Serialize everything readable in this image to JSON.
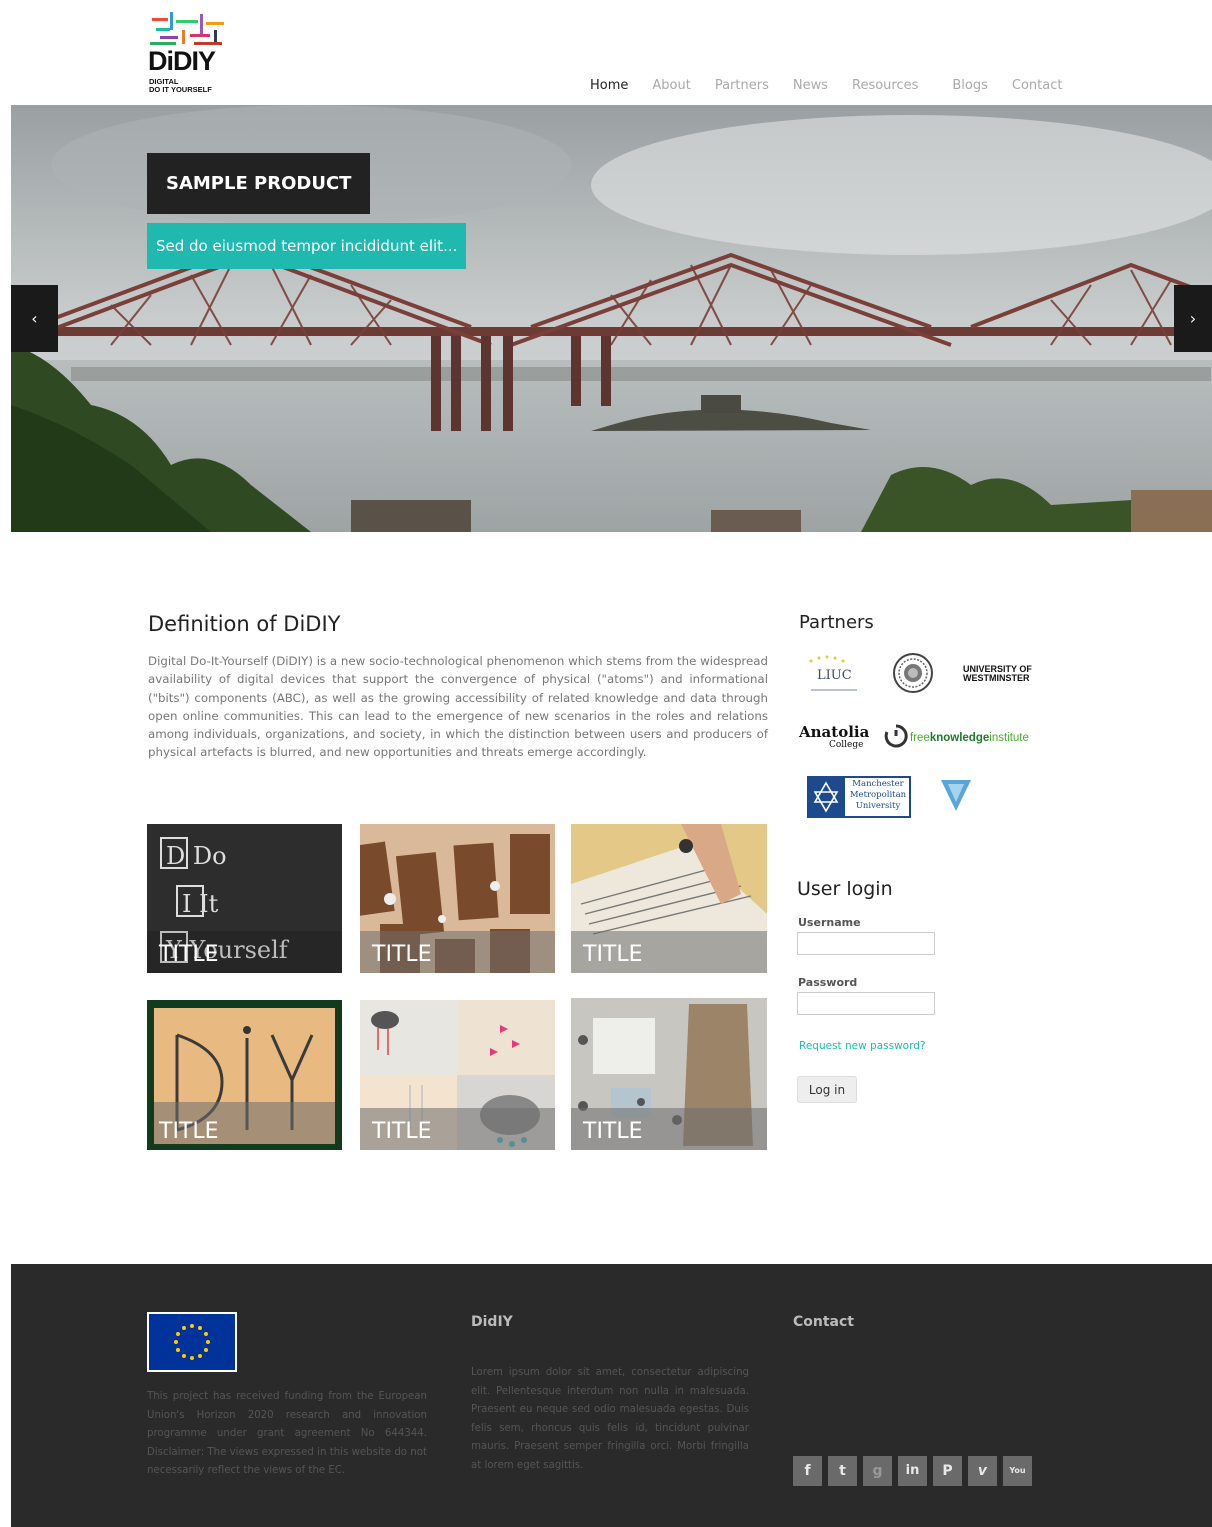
{
  "brand": {
    "name": "DiDIY",
    "tagline_line1": "DIGITAL",
    "tagline_line2": "DO IT YOURSELF"
  },
  "nav": {
    "items": [
      {
        "label": "Home",
        "active": true
      },
      {
        "label": "About"
      },
      {
        "label": "Partners"
      },
      {
        "label": "News"
      },
      {
        "label": "Resources"
      },
      {
        "label": "Blogs"
      },
      {
        "label": "Contact"
      }
    ]
  },
  "slider": {
    "title": "SAMPLE PRODUCT",
    "caption": "Sed do eiusmod tempor incididunt elit...",
    "prev_icon": "chevron-left-icon",
    "next_icon": "chevron-right-icon",
    "prev_glyph": "‹",
    "next_glyph": "›"
  },
  "definition": {
    "title": "Definition of DiDIY",
    "text": "Digital Do-It-Yourself (DiDIY) is a new socio-technological phenomenon which stems from the widespread availability of digital devices that support the convergence of physical (\"atoms\") and informational (\"bits\") components (ABC), as well as the growing accessibility of related knowledge and data through open online communities. This can lead to the emergence of new scenarios in the roles and relations among individuals, organizations, and society, in which the distinction between users and producers of physical artefacts is blurred, and new opportunities and threats emerge accordingly."
  },
  "tiles": [
    {
      "label": "TITLE",
      "art_text": [
        "D Do",
        "I It",
        "Y Yourself"
      ]
    },
    {
      "label": "TITLE"
    },
    {
      "label": "TITLE"
    },
    {
      "label": "TITLE",
      "art_text": [
        "DIY"
      ]
    },
    {
      "label": "TITLE"
    },
    {
      "label": "TITLE"
    }
  ],
  "partners": {
    "title": "Partners",
    "logos": [
      {
        "name": "LIUC",
        "text": "LIUC"
      },
      {
        "name": "university-seal"
      },
      {
        "name": "University of Westminster",
        "line1": "UNIVERSITY OF",
        "line2": "WESTMINSTER"
      },
      {
        "name": "Anatolia College",
        "line1": "Anatolia",
        "line2": "College"
      },
      {
        "name": "freeknowledgeinstitute",
        "part1": "free",
        "part2": "knowledge",
        "part3": "institute"
      },
      {
        "name": "Manchester Metropolitan University",
        "line1": "Manchester",
        "line2": "Metropolitan",
        "line3": "University"
      },
      {
        "name": "triangle-logo"
      }
    ]
  },
  "login": {
    "title": "User login",
    "username_label": "Username",
    "username_value": "",
    "password_label": "Password",
    "password_value": "",
    "request_link": "Request new password?",
    "submit_label": "Log in"
  },
  "footer": {
    "eu_text": "This project has received funding from the European Union's Horizon 2020 research and innovation programme under grant agreement No 644344. Disclaimer: The views expressed in this website do not necessarily reflect the views of the EC.",
    "didiy_heading": "DidIY",
    "didiy_text": "Lorem ipsum dolor sit amet, consectetur adipiscing elit. Pellentesque interdum non nulla in malesuada. Praesent eu neque sed odio malesuada egestas. Duis felis sem, rhoncus quis felis id, tincidunt pulvinar mauris. Praesent semper fringilla orci. Morbi fringilla at lorem eget sagittis.",
    "contact_heading": "Contact",
    "socials": [
      {
        "name": "facebook-icon",
        "glyph": "f"
      },
      {
        "name": "twitter-icon",
        "glyph": "t"
      },
      {
        "name": "google-plus-icon",
        "glyph": "g"
      },
      {
        "name": "linkedin-icon",
        "glyph": "in"
      },
      {
        "name": "pinterest-icon",
        "glyph": "P"
      },
      {
        "name": "vimeo-icon",
        "glyph": "v"
      },
      {
        "name": "youtube-icon",
        "glyph": "You"
      }
    ]
  },
  "colors": {
    "accent": "#1fb9b0",
    "dark": "#222222",
    "footer_bg": "#2a2a2a",
    "eu_blue": "#003399",
    "eu_star": "#ffcc00"
  }
}
